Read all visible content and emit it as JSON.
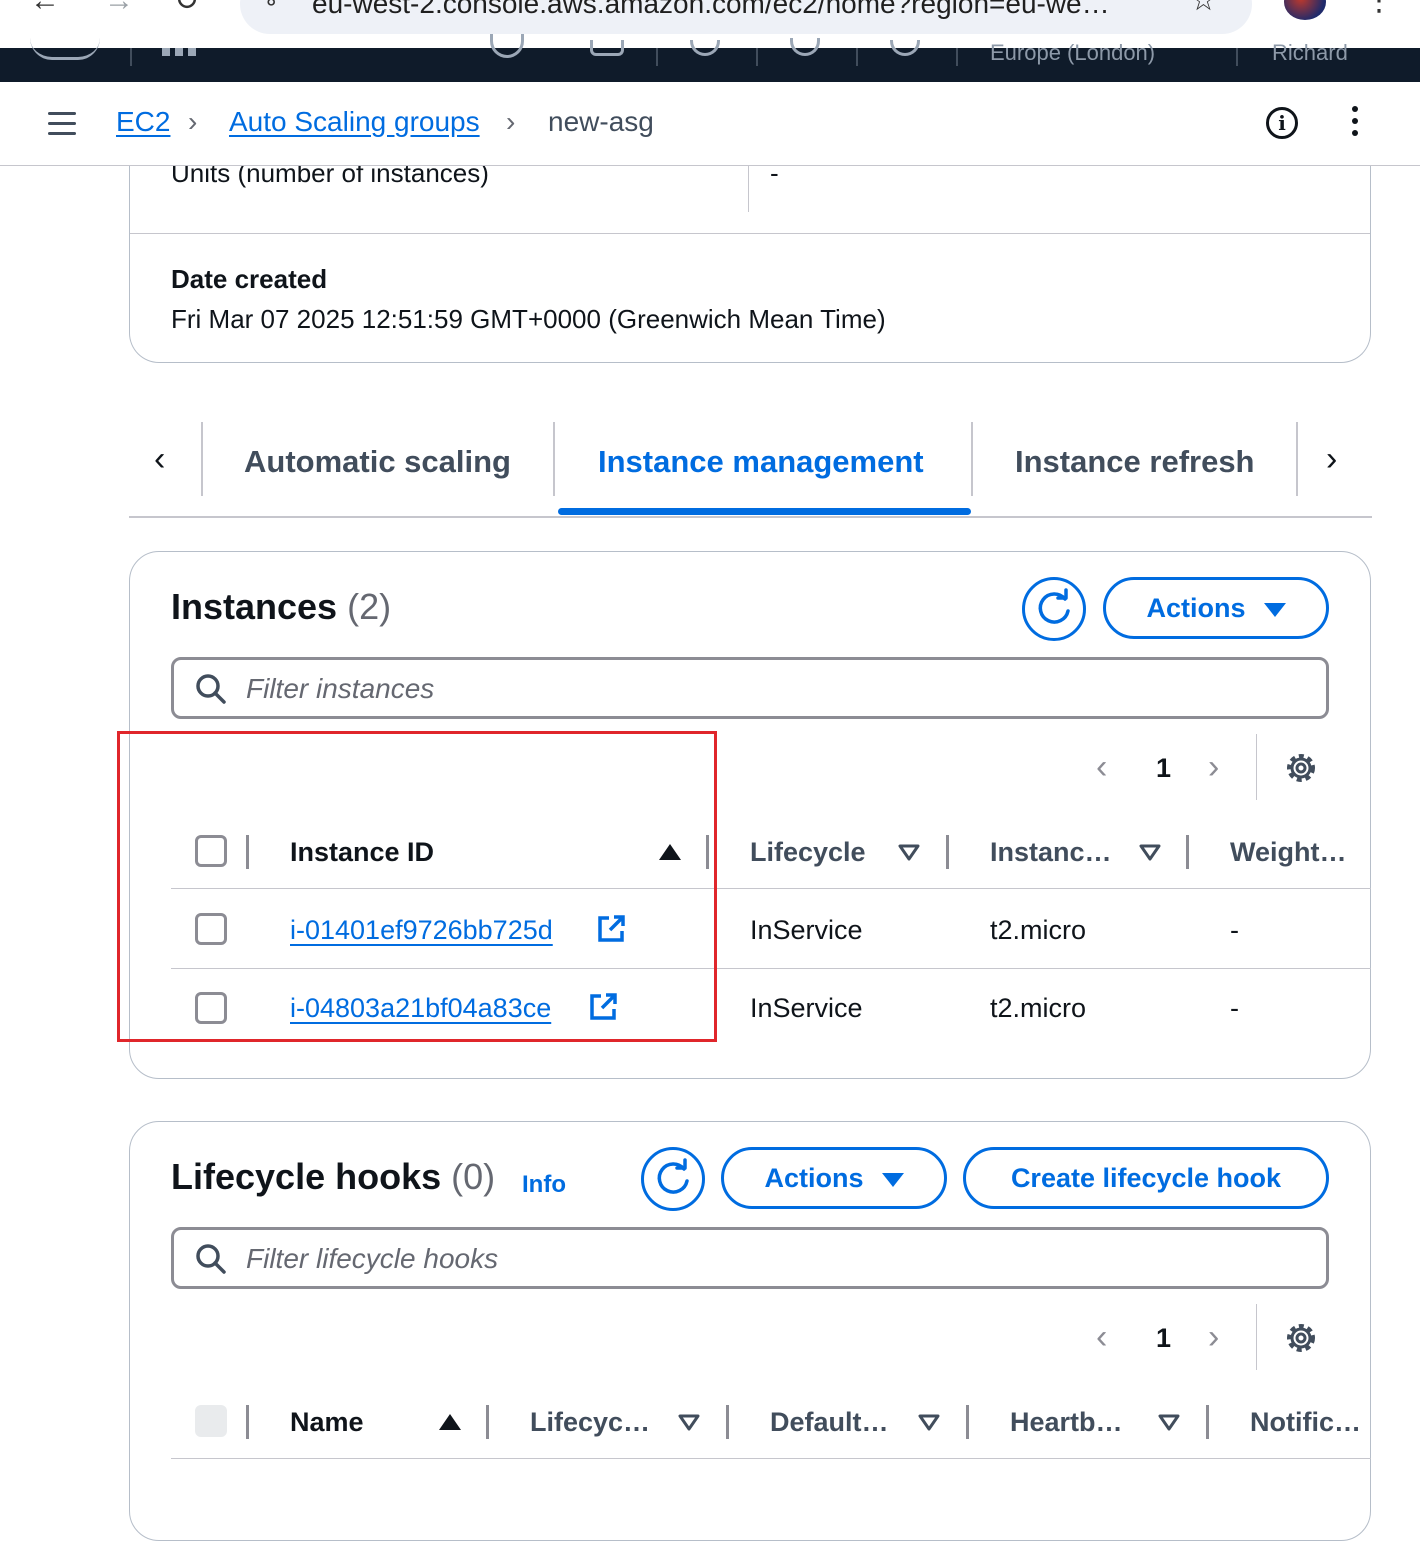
{
  "browser": {
    "url": "eu-west-2.console.aws.amazon.com/ec2/home?region=eu-we…"
  },
  "aws_nav": {
    "region": "Europe (London)",
    "user": "Richard"
  },
  "breadcrumb": {
    "items": [
      "EC2",
      "Auto Scaling groups"
    ],
    "current": "new-asg"
  },
  "details": {
    "units_label": "Units (number of instances)",
    "units_value": "-",
    "date_created_label": "Date created",
    "date_created_value": "Fri Mar 07 2025 12:51:59 GMT+0000 (Greenwich Mean Time)"
  },
  "tabs": {
    "items": [
      "Automatic scaling",
      "Instance management",
      "Instance refresh"
    ],
    "active": "Instance management"
  },
  "instances": {
    "title": "Instances",
    "count": "(2)",
    "actions_label": "Actions",
    "filter_placeholder": "Filter instances",
    "page": "1",
    "columns": [
      "Instance ID",
      "Lifecycle",
      "Instanc…",
      "Weight…"
    ],
    "rows": [
      {
        "instance_id": "i-01401ef9726bb725d",
        "lifecycle": "InService",
        "instance_type": "t2.micro",
        "weight": "-"
      },
      {
        "instance_id": "i-04803a21bf04a83ce",
        "lifecycle": "InService",
        "instance_type": "t2.micro",
        "weight": "-"
      }
    ]
  },
  "lifecycle_hooks": {
    "title": "Lifecycle hooks",
    "count": "(0)",
    "info_label": "Info",
    "actions_label": "Actions",
    "create_label": "Create lifecycle hook",
    "filter_placeholder": "Filter lifecycle hooks",
    "page": "1",
    "columns": [
      "Name",
      "Lifecyc…",
      "Default…",
      "Heartb…",
      "Notific…"
    ]
  },
  "colors": {
    "accent": "#006ce0",
    "highlight": "#e0262b",
    "nav_bg": "#0f1b2a"
  },
  "icons": [
    "back-icon",
    "forward-icon",
    "reload-icon",
    "site-info-icon",
    "star-icon",
    "menu-icon",
    "info-icon",
    "more-icon",
    "refresh-icon",
    "search-icon",
    "settings-icon",
    "external-link-icon"
  ]
}
